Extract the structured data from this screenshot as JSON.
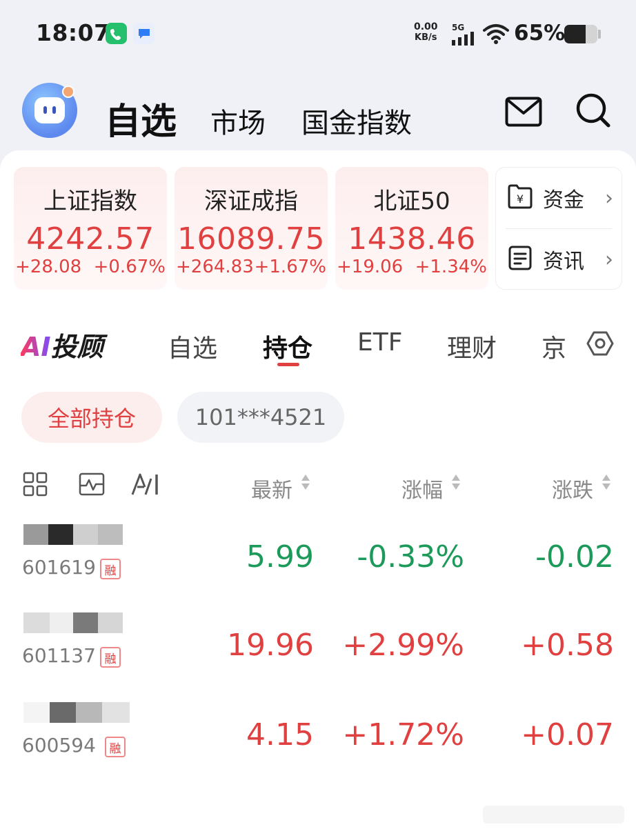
{
  "status_bar": {
    "time": "18:07",
    "net_speed_value": "0.00",
    "net_speed_unit": "KB/s",
    "network": "5G",
    "battery_percent": "65%",
    "battery_level": 0.65
  },
  "header": {
    "tabs": [
      "自选",
      "市场",
      "国金指数"
    ],
    "active_tab": "自选"
  },
  "indices": [
    {
      "name": "上证指数",
      "value": "4242.57",
      "change": "+28.08",
      "pct": "+0.67%"
    },
    {
      "name": "深证成指",
      "value": "16089.75",
      "change": "+264.83",
      "pct": "+1.67%"
    },
    {
      "name": "北证50",
      "value": "1438.46",
      "change": "+19.06",
      "pct": "+1.34%"
    }
  ],
  "side_links": [
    {
      "label": "资金",
      "icon": "fund-icon"
    },
    {
      "label": "资讯",
      "icon": "news-icon"
    }
  ],
  "tabs": {
    "ai_logo_ai": "AI",
    "ai_logo_text": "投顾",
    "items": [
      "自选",
      "持仓",
      "ETF",
      "理财",
      "京"
    ],
    "active": "持仓"
  },
  "chips": {
    "all": "全部持仓",
    "account": "101***4521"
  },
  "columns": {
    "latest": "最新",
    "pct": "涨幅",
    "change": "涨跌"
  },
  "rows": [
    {
      "code": "601619",
      "badge": "融",
      "latest": "5.99",
      "pct": "-0.33%",
      "change": "-0.02",
      "trend": "down"
    },
    {
      "code": "601137",
      "badge": "融",
      "latest": "19.96",
      "pct": "+2.99%",
      "change": "+0.58",
      "trend": "up"
    },
    {
      "code": "600594",
      "badge": "融",
      "latest": "4.15",
      "pct": "+1.72%",
      "change": "+0.07",
      "trend": "up"
    }
  ],
  "colors": {
    "up": "#e04040",
    "down": "#1c9a5a",
    "accent": "#e04040"
  }
}
